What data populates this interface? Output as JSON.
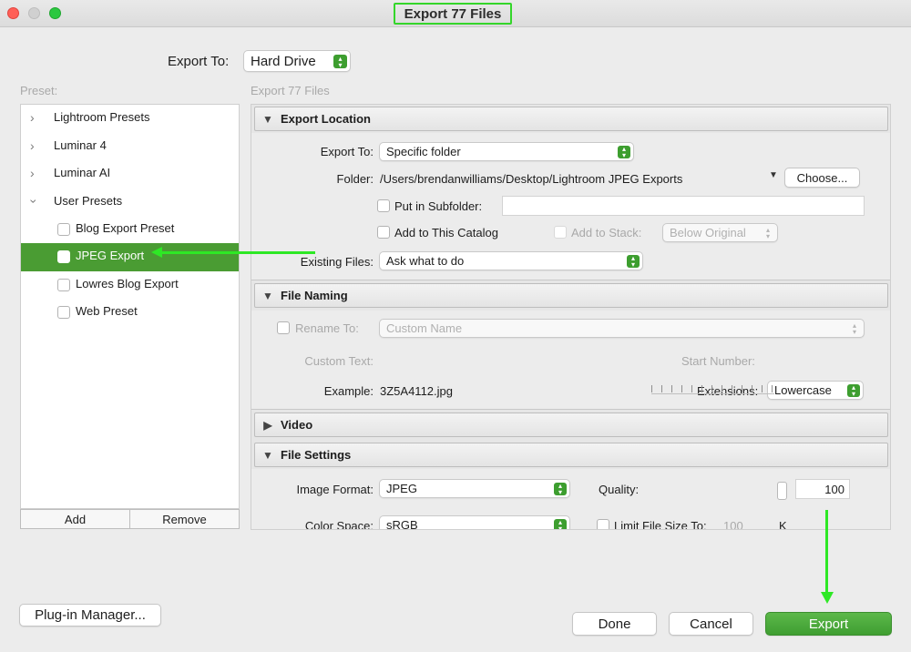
{
  "window": {
    "title": "Export 77 Files"
  },
  "export_to": {
    "label": "Export To:",
    "value": "Hard Drive"
  },
  "preset": {
    "heading": "Preset:",
    "items": [
      {
        "label": "Lightroom Presets"
      },
      {
        "label": "Luminar 4"
      },
      {
        "label": "Luminar AI"
      },
      {
        "label": "User Presets"
      },
      {
        "label": "Blog Export Preset"
      },
      {
        "label": "JPEG Export"
      },
      {
        "label": "Lowres Blog Export"
      },
      {
        "label": "Web Preset"
      }
    ],
    "add_label": "Add",
    "remove_label": "Remove"
  },
  "right_heading": "Export 77 Files",
  "export_location": {
    "title": "Export Location",
    "export_to_label": "Export To:",
    "export_to_value": "Specific folder",
    "folder_label": "Folder:",
    "folder_path": "/Users/brendanwilliams/Desktop/Lightroom JPEG Exports",
    "choose_label": "Choose...",
    "subfolder_label": "Put in Subfolder:",
    "add_catalog_label": "Add to This Catalog",
    "add_stack_label": "Add to Stack:",
    "stack_value": "Below Original",
    "existing_label": "Existing Files:",
    "existing_value": "Ask what to do"
  },
  "file_naming": {
    "title": "File Naming",
    "rename_label": "Rename To:",
    "rename_value": "Custom Name",
    "custom_text_label": "Custom Text:",
    "start_number_label": "Start Number:",
    "example_label": "Example:",
    "example_value": "3Z5A4112.jpg",
    "extensions_label": "Extensions:",
    "extensions_value": "Lowercase"
  },
  "video": {
    "title": "Video"
  },
  "file_settings": {
    "title": "File Settings",
    "image_format_label": "Image Format:",
    "image_format_value": "JPEG",
    "quality_label": "Quality:",
    "quality_value": "100",
    "color_space_label": "Color Space:",
    "color_space_value": "sRGB",
    "limit_label": "Limit File Size To:",
    "limit_value": "100",
    "limit_unit": "K"
  },
  "footer": {
    "plugin_label": "Plug-in Manager...",
    "done_label": "Done",
    "cancel_label": "Cancel",
    "export_label": "Export"
  },
  "colors": {
    "accent": "#3f9e31",
    "annotation": "#2ee825"
  },
  "icons": [
    "chevron-right-icon",
    "chevron-down-icon",
    "disclosure-triangle-icon",
    "popup-stepper-icon",
    "dropdown-arrow-icon"
  ]
}
